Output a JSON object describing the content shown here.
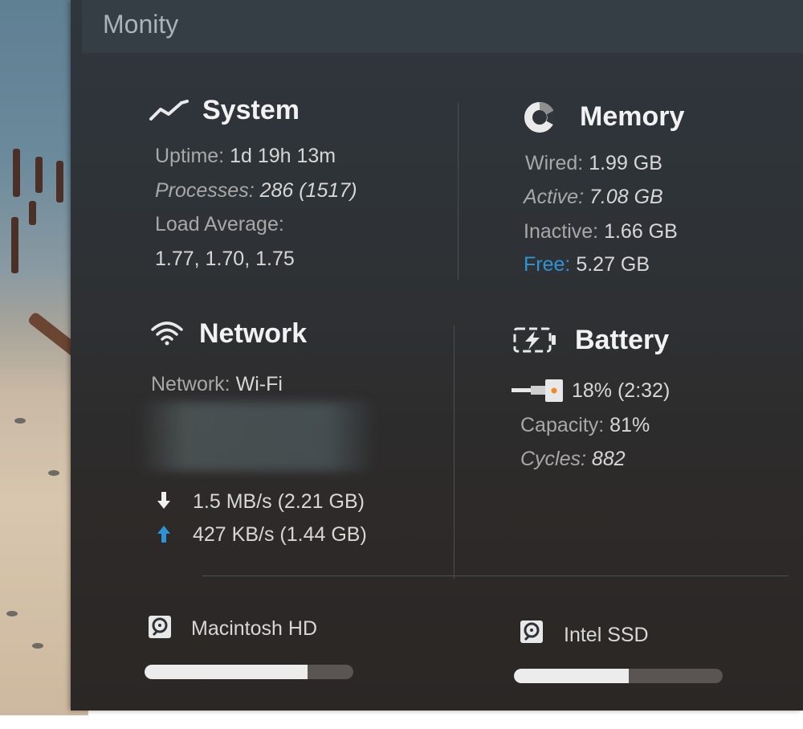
{
  "app": {
    "title": "Monity"
  },
  "system": {
    "title": "System",
    "uptime_label": "Uptime:",
    "uptime_value": "1d 19h 13m",
    "processes_label": "Processes:",
    "processes_value": "286 (1517)",
    "load_label": "Load Average:",
    "load_value": "1.77, 1.70, 1.75"
  },
  "memory": {
    "title": "Memory",
    "wired_label": "Wired:",
    "wired_value": "1.99 GB",
    "active_label": "Active:",
    "active_value": "7.08 GB",
    "inactive_label": "Inactive:",
    "inactive_value": "1.66 GB",
    "free_label": "Free:",
    "free_value": "5.27 GB"
  },
  "network": {
    "title": "Network",
    "network_label": "Network:",
    "network_value": "Wi-Fi",
    "download": "1.5 MB/s (2.21 GB)",
    "upload": "427 KB/s (1.44 GB)"
  },
  "battery": {
    "title": "Battery",
    "charge": "18% (2:32)",
    "capacity_label": "Capacity:",
    "capacity_value": "81%",
    "cycles_label": "Cycles:",
    "cycles_value": "882"
  },
  "disks": [
    {
      "name": "Macintosh HD",
      "used_fraction": 0.78
    },
    {
      "name": "Intel SSD",
      "used_fraction": 0.55
    }
  ],
  "colors": {
    "accent": "#2f94d6",
    "battery_plug": "#f08a24"
  }
}
